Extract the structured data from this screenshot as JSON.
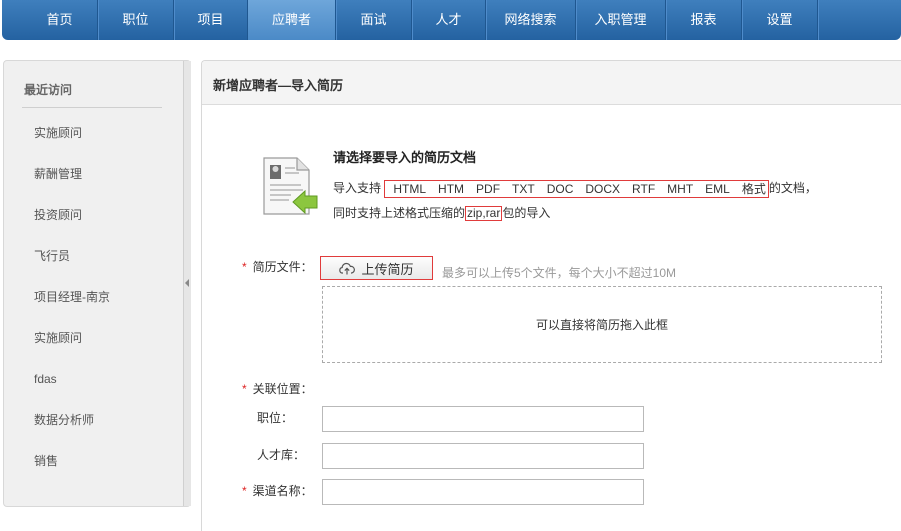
{
  "nav": {
    "items": [
      "首页",
      "职位",
      "项目",
      "应聘者",
      "面试",
      "人才",
      "网络搜索",
      "入职管理",
      "报表",
      "设置"
    ],
    "active_index": 3
  },
  "sidebar": {
    "title": "最近访问",
    "items": [
      "实施顾问",
      "薪酬管理",
      "投资顾问",
      "飞行员",
      "项目经理-南京",
      "实施顾问",
      "fdas",
      "数据分析师",
      "销售"
    ]
  },
  "main": {
    "title": "新增应聘者—导入简历",
    "intro": {
      "heading": "请选择要导入的简历文档",
      "line1_prefix": "导入支持",
      "formats": [
        "HTML",
        "HTM",
        "PDF",
        "TXT",
        "DOC",
        "DOCX",
        "RTF",
        "MHT",
        "EML",
        "格式"
      ],
      "line1_suffix": "的文档，",
      "line2_prefix": "同时支持上述格式压缩的",
      "line2_zip": "zip,rar",
      "line2_suffix": "包的导入"
    },
    "resume_field": {
      "required_mark": "*",
      "label": "简历文件：",
      "upload_button": "上传简历",
      "hint": "最多可以上传5个文件，每个大小不超过10M",
      "dropzone_text": "可以直接将简历拖入此框"
    },
    "relation": {
      "required_mark": "*",
      "label": "关联位置：",
      "position_label": "职位：",
      "position_value": "",
      "talent_pool_label": "人才库：",
      "talent_pool_value": "",
      "channel_required_mark": "*",
      "channel_label": "渠道名称：",
      "channel_value": ""
    }
  },
  "colors": {
    "nav_bg": "#2a68a6",
    "nav_active": "#5b97d0",
    "required": "#dd2222",
    "highlight_border": "#e03b3b"
  },
  "icons": {
    "resume_doc": "document-import-icon",
    "upload": "cloud-upload-icon",
    "collapse": "collapse-left-icon"
  }
}
